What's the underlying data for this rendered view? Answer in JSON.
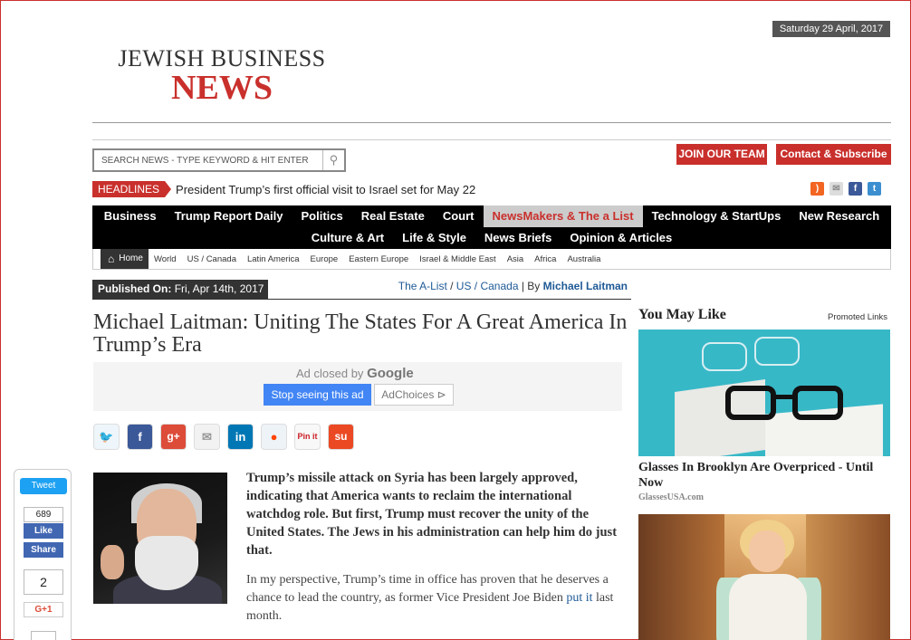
{
  "header": {
    "date": "Saturday 29 April, 2017",
    "logo_line1": "JEWISH BUSINESS",
    "logo_line2": "NEWS"
  },
  "search": {
    "placeholder": "SEARCH NEWS - TYPE KEYWORD & HIT ENTER"
  },
  "buttons": {
    "join": "JOIN OUR TEAM",
    "contact": "Contact & Subscribe"
  },
  "headlines": {
    "tag": "HEADLINES",
    "text": "President Trump’s first official visit to Israel set for May 22"
  },
  "social_top": [
    "rss-icon",
    "mail-icon",
    "facebook-icon",
    "twitter-icon"
  ],
  "nav": {
    "row1": [
      "Business",
      "Trump Report Daily",
      "Politics",
      "Real Estate",
      "Court",
      "NewsMakers & The a List",
      "Technology & StartUps",
      "New Research"
    ],
    "row2": [
      "Culture & Art",
      "Life & Style",
      "News Briefs",
      "Opinion & Articles"
    ],
    "active": "NewsMakers & The a List"
  },
  "subnav": {
    "home": "Home",
    "items": [
      "World",
      "US / Canada",
      "Latin America",
      "Europe",
      "Eastern Europe",
      "Israel & Middle East",
      "Asia",
      "Africa",
      "Australia"
    ]
  },
  "article": {
    "published_label": "Published On:",
    "published_value": "Fri, Apr 14th, 2017",
    "crumb_1": "The A-List",
    "crumb_sep": " / ",
    "crumb_2": "US / Canada",
    "by_label": " | By ",
    "author": "Michael Laitman",
    "title": "Michael Laitman: Uniting The States For A Great America In Trump’s Era",
    "lead": "Trump’s missile attack on Syria has been largely approved, indicating that America wants to reclaim the international watchdog role. But first, Trump must recover the unity of the United States. The Jews in his administration can help him do just that.",
    "para_before": "In my perspective, Trump’s time in office has proven that he deserves a chance to lead the country, as former Vice President Joe Biden ",
    "para_link": "put it",
    "para_after": " last month."
  },
  "ad": {
    "closed_by": "Ad closed by",
    "google": "Google",
    "stop": "Stop seeing this ad",
    "choices": "AdChoices ⊳"
  },
  "share_icons": [
    "twitter",
    "facebook",
    "google-plus",
    "email",
    "linkedin",
    "reddit",
    "pinterest",
    "stumbleupon"
  ],
  "share_glyphs": {
    "twitter": "🐦",
    "facebook": "f",
    "google": "g+",
    "email": "✉",
    "linkedin": "in",
    "reddit": "●",
    "pinterest": "Pin it",
    "stumble": "su"
  },
  "floating_share": {
    "tweet": "Tweet",
    "fb_count": "689",
    "like": "Like",
    "share": "Share",
    "g_count": "2",
    "gplus": "G+1"
  },
  "sidebar": {
    "title": "You May Like",
    "promo": "Promoted Links",
    "item1_caption": "Glasses In Brooklyn Are Overpriced - Until Now",
    "item1_source": "GlassesUSA.com"
  },
  "colors": {
    "brand_red": "#c9302c",
    "link_blue": "#1e5a96",
    "nav_bg": "#000000"
  }
}
